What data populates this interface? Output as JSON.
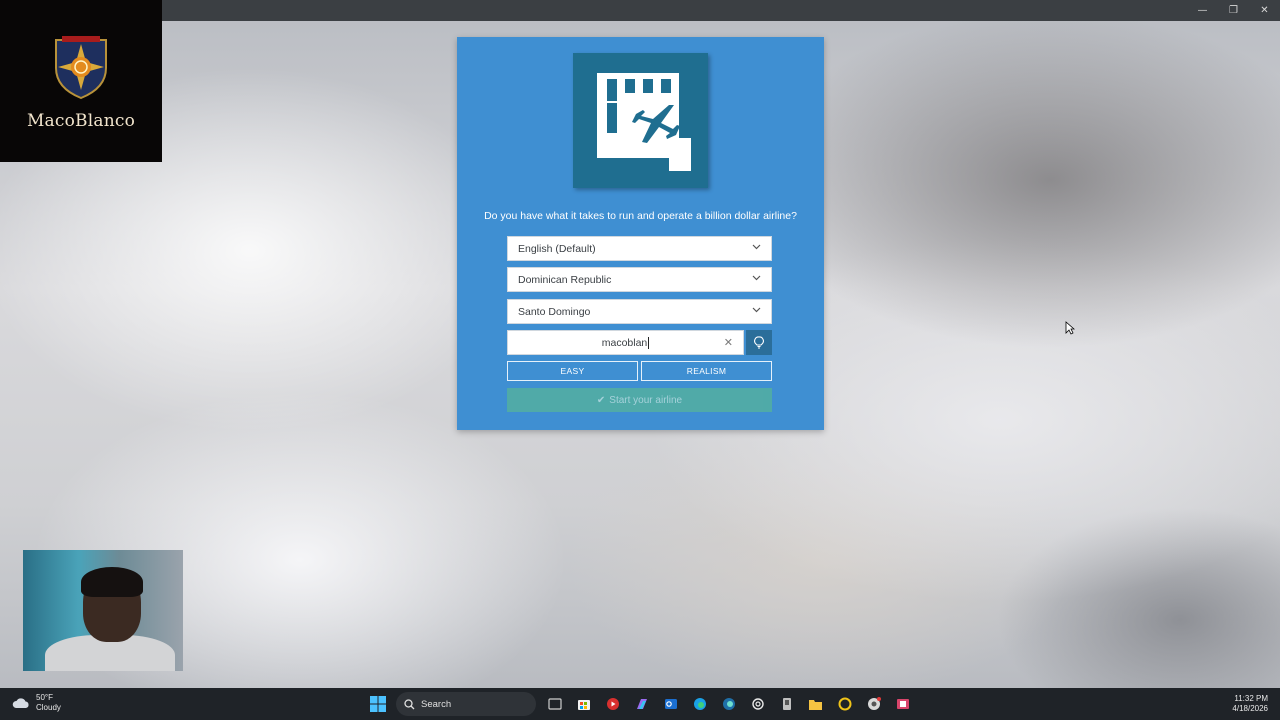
{
  "window": {
    "minimize_glyph": "—",
    "restore_glyph": "❐",
    "close_glyph": "✕"
  },
  "overlay": {
    "logo_text": "MacoBlanco"
  },
  "game": {
    "tagline": "Do you have what it takes to run and operate a billion dollar airline?",
    "language_select": "English (Default)",
    "country_select": "Dominican Republic",
    "city_select": "Santo Domingo",
    "airline_name_value": "macoblan",
    "easy_label": "EASY",
    "realism_label": "REALISM",
    "start_label": "Start your airline",
    "accent_color": "#3f8fd2",
    "icon_color": "#1f6e90",
    "start_color": "#56b39a"
  },
  "taskbar": {
    "weather_temp": "50°F",
    "weather_desc": "Cloudy",
    "search_label": "Search",
    "time": "11:32 PM",
    "date": "4/18/2026"
  }
}
